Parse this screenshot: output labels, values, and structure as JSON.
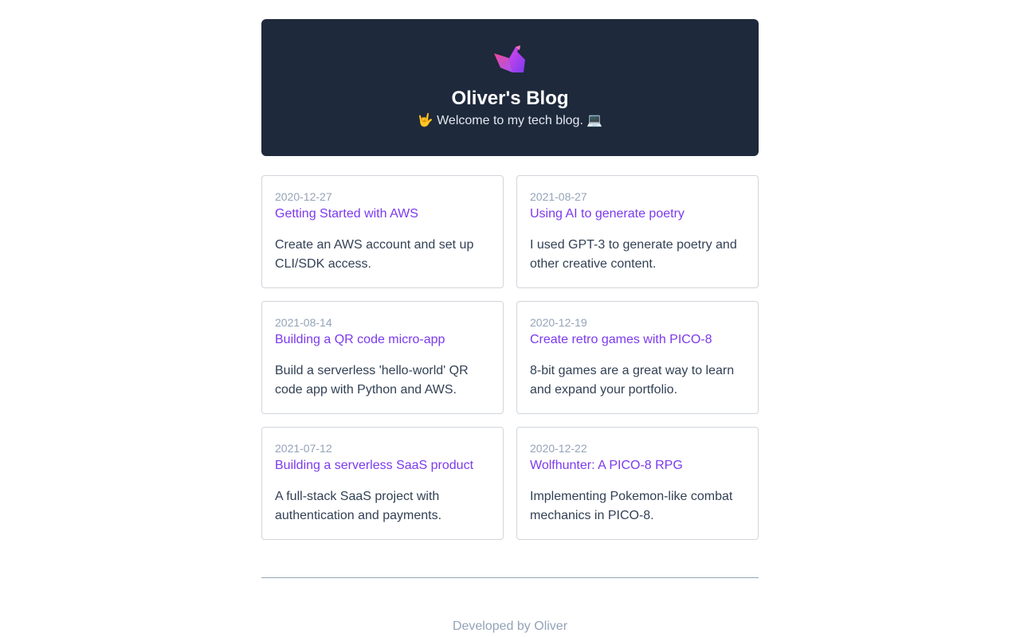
{
  "header": {
    "logo_icon": "origami-swan-icon",
    "title": "Oliver's Blog",
    "subtitle": "🤟 Welcome to my tech blog. 💻",
    "background": "#1e293b"
  },
  "posts": [
    {
      "date": "2020-12-27",
      "title": "Getting Started with AWS",
      "description": "Create an AWS account and set up CLI/SDK access."
    },
    {
      "date": "2021-08-27",
      "title": "Using AI to generate poetry",
      "description": "I used GPT-3 to generate poetry and other creative content."
    },
    {
      "date": "2021-08-14",
      "title": "Building a QR code micro-app",
      "description": "Build a serverless 'hello-world' QR code app with Python and AWS."
    },
    {
      "date": "2020-12-19",
      "title": "Create retro games with PICO-8",
      "description": "8-bit games are a great way to learn and expand your portfolio."
    },
    {
      "date": "2021-07-12",
      "title": "Building a serverless SaaS product",
      "description": "A full-stack SaaS project with authentication and payments."
    },
    {
      "date": "2020-12-22",
      "title": "Wolfhunter: A PICO-8 RPG",
      "description": "Implementing Pokemon-like combat mechanics in PICO-8."
    }
  ],
  "footer": {
    "text": "Developed by Oliver"
  },
  "colors": {
    "accent": "#7c3aed",
    "muted": "#94a3b8",
    "text": "#334155",
    "border": "#d1d5db"
  }
}
